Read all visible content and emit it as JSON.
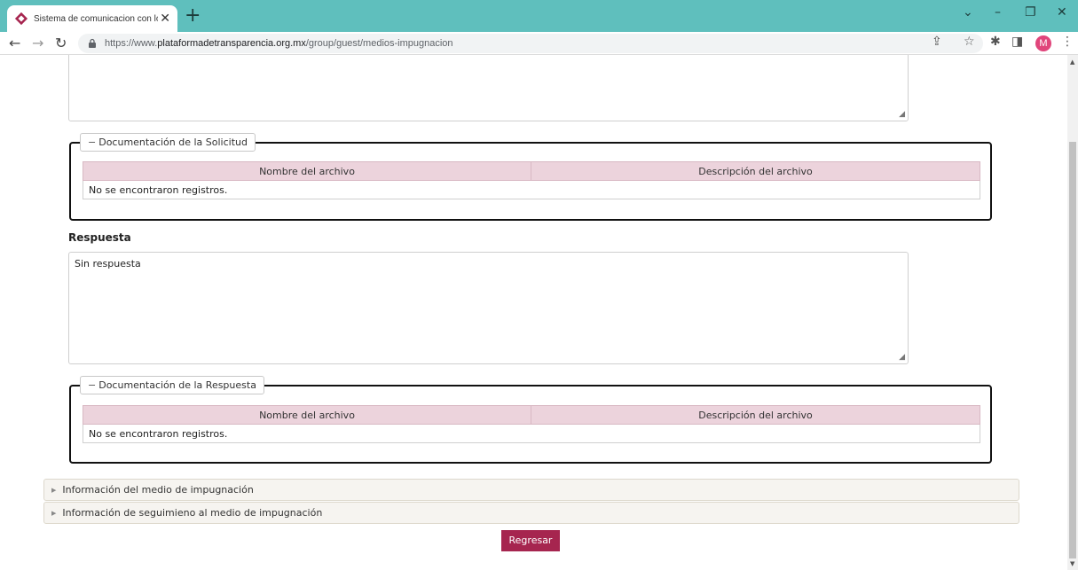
{
  "browser": {
    "tab_title": "Sistema de comunicacion con los",
    "new_tab": "+",
    "url_prefix": "https://www.",
    "url_domain": "plataformadetransparencia.org.mx",
    "url_path": "/group/guest/medios-impugnacion",
    "profile_initial": "M",
    "accent_color": "#5fbfbd"
  },
  "solicitud_docs": {
    "legend": "Documentación de la Solicitud",
    "columns": [
      "Nombre del archivo",
      "Descripción del archivo"
    ],
    "empty_message": "No se encontraron registros."
  },
  "respuesta": {
    "label": "Respuesta",
    "value": "Sin respuesta"
  },
  "respuesta_docs": {
    "legend": "Documentación de la Respuesta",
    "columns": [
      "Nombre del archivo",
      "Descripción del archivo"
    ],
    "empty_message": "No se encontraron registros."
  },
  "accordions": [
    {
      "label": "Información del medio de impugnación"
    },
    {
      "label": "Información de seguimieno al medio de impugnación"
    }
  ],
  "actions": {
    "back_label": "Regresar",
    "back_color": "#a6254f"
  },
  "colors": {
    "table_header": "#ecd3dc"
  }
}
